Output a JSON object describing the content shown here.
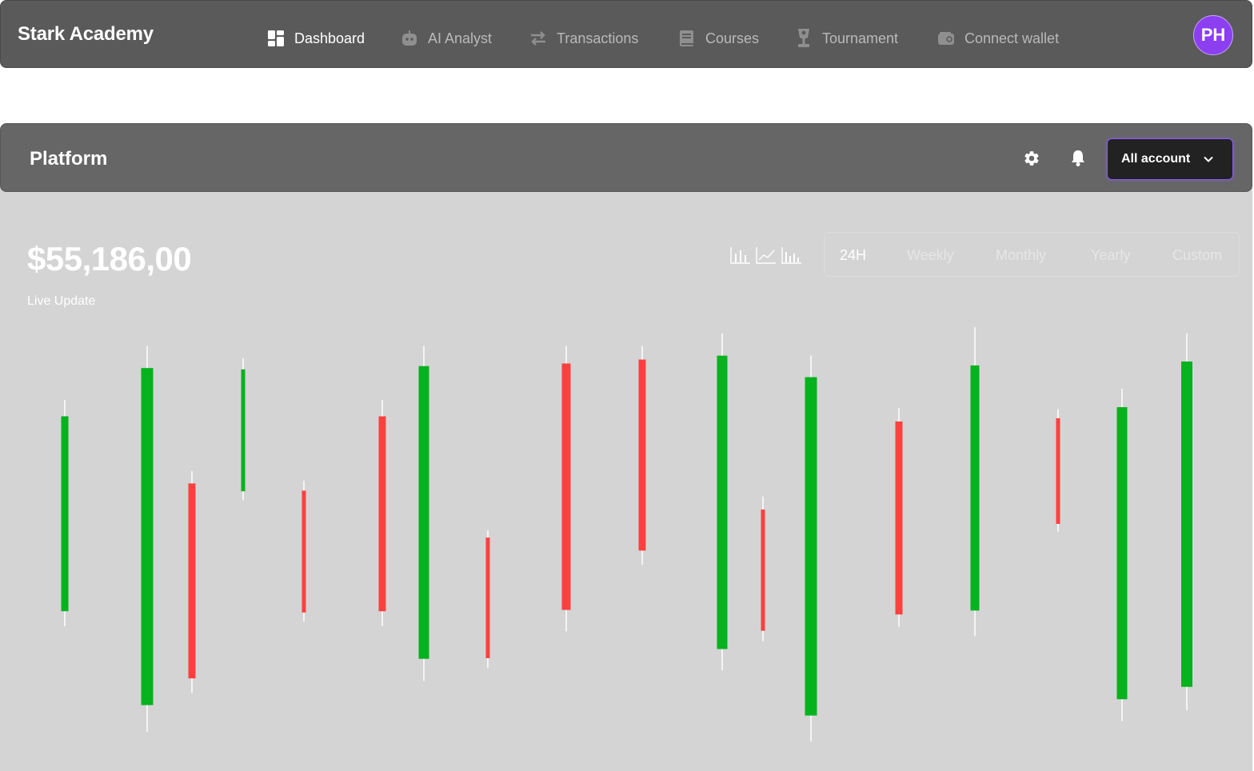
{
  "app": {
    "brand": "Stark Academy",
    "avatar_initials": "PH"
  },
  "nav": [
    {
      "label": "Dashboard",
      "icon": "dashboard-grid-icon",
      "active": true
    },
    {
      "label": "AI Analyst",
      "icon": "robot-icon",
      "active": false
    },
    {
      "label": "Transactions",
      "icon": "swap-arrows-icon",
      "active": false
    },
    {
      "label": "Courses",
      "icon": "book-icon",
      "active": false
    },
    {
      "label": "Tournament",
      "icon": "trophy-icon",
      "active": false
    },
    {
      "label": "Connect wallet",
      "icon": "wallet-icon",
      "active": false
    }
  ],
  "panel": {
    "title": "Platform",
    "account_selector": "All account",
    "header_icons": [
      "gear-icon",
      "bell-icon"
    ],
    "balance": "$55,186,00",
    "live_label": "Live Update",
    "chart_type_icons": [
      "bar-chart-icon",
      "line-chart-icon",
      "candle-chart-icon"
    ],
    "periods": [
      "24H",
      "Weekly",
      "Monthly",
      "Yearly",
      "Custom"
    ],
    "active_period": "24H"
  },
  "colors": {
    "up": "#06b21e",
    "down": "#fc4040",
    "accent": "#8b3ff0",
    "nav_bg": "#5a5a5a",
    "panel_header_bg": "#666666",
    "panel_bg": "#d4d4d4"
  },
  "chart_data": {
    "type": "candlestick",
    "candles": [
      {
        "open": 22.3,
        "close": 52.2,
        "high": 54.7,
        "low": 20.0
      },
      {
        "open": 7.9,
        "close": 59.6,
        "high": 63.0,
        "low": 3.8
      },
      {
        "open": 41.9,
        "close": 12.0,
        "high": 43.8,
        "low": 9.8
      },
      {
        "open": 40.7,
        "close": 59.4,
        "high": 61.1,
        "low": 39.3
      },
      {
        "open": 40.8,
        "close": 22.1,
        "high": 42.3,
        "low": 20.7
      },
      {
        "open": 52.2,
        "close": 22.3,
        "high": 54.7,
        "low": 20.0
      },
      {
        "open": 15.0,
        "close": 59.9,
        "high": 63.0,
        "low": 11.6
      },
      {
        "open": 33.6,
        "close": 15.1,
        "high": 34.7,
        "low": 13.6
      },
      {
        "open": 60.3,
        "close": 22.5,
        "high": 63.0,
        "low": 19.2
      },
      {
        "open": 60.9,
        "close": 31.6,
        "high": 63.0,
        "low": 29.4
      },
      {
        "open": 16.5,
        "close": 61.5,
        "high": 64.9,
        "low": 13.2
      },
      {
        "open": 37.9,
        "close": 19.3,
        "high": 39.9,
        "low": 17.7
      },
      {
        "open": 6.3,
        "close": 58.2,
        "high": 61.5,
        "low": 2.3
      },
      {
        "open": 51.4,
        "close": 21.8,
        "high": 53.5,
        "low": 19.9
      },
      {
        "open": 22.4,
        "close": 60.0,
        "high": 65.9,
        "low": 18.5
      },
      {
        "open": 51.9,
        "close": 35.7,
        "high": 53.3,
        "low": 34.5
      },
      {
        "open": 8.8,
        "close": 53.6,
        "high": 56.4,
        "low": 5.4
      },
      {
        "open": 10.7,
        "close": 60.6,
        "high": 64.9,
        "low": 7.1
      }
    ]
  }
}
